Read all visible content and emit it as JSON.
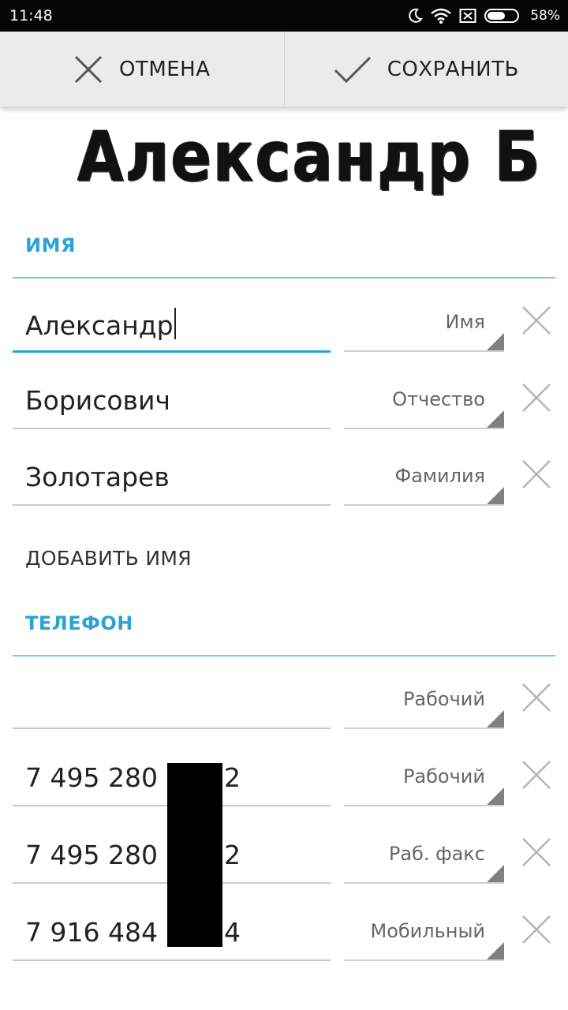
{
  "status_bar": {
    "time": "11:48",
    "battery": "58%"
  },
  "toolbar": {
    "cancel_label": "ОТМЕНА",
    "save_label": "СОХРАНИТЬ"
  },
  "banner": {
    "text": "Александр Б"
  },
  "name_section": {
    "header": "ИМЯ",
    "fields": [
      {
        "value": "Александр",
        "type": "Имя"
      },
      {
        "value": "Борисович",
        "type": "Отчество"
      },
      {
        "value": "Золотарев",
        "type": "Фамилия"
      }
    ],
    "add_label": "ДОБАВИТЬ ИМЯ"
  },
  "phone_section": {
    "header": "ТЕЛЕФОН",
    "fields": [
      {
        "value": "",
        "type": "Рабочий"
      },
      {
        "value_prefix": "7 495 280",
        "value_suffix": "2",
        "type": "Рабочий"
      },
      {
        "value_prefix": "7 495 280",
        "value_suffix": "2",
        "type": "Раб. факс"
      },
      {
        "value_prefix": "7 916 484",
        "value_suffix": "4",
        "type": "Мобильный"
      }
    ]
  }
}
